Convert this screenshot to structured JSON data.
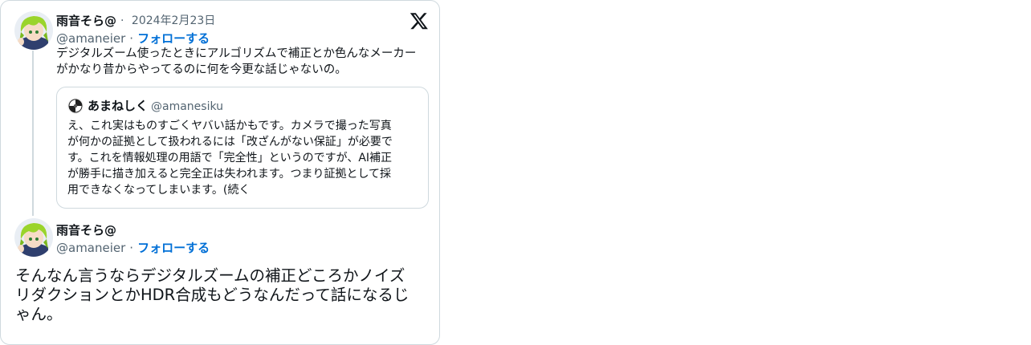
{
  "tweet1": {
    "name": "雨音そら@",
    "date": "2024年2月23日",
    "handle": "@amaneier",
    "follow": "フォローする",
    "text_lines": [
      "デジタルズーム使ったときにアルゴリズムで補正とか色んなメーカー",
      "がかなり昔からやってるのに何を今更な話じゃないの。"
    ]
  },
  "quote": {
    "name": "あまねしく",
    "handle": "@amanesiku",
    "text_lines": [
      "え、これ実はものすごくヤバい話かもです。カメラで撮った写真",
      "が何かの証拠として扱われるには「改ざんがない保証」が必要で",
      "す。これを情報処理の用語で「完全性」というのですが、AI補正",
      "が勝手に描き加えると完全正は失われます。つまり証拠として採",
      "用できなくなってしまいます。(続く"
    ]
  },
  "tweet2": {
    "name": "雨音そら@",
    "handle": "@amaneier",
    "follow": "フォローする",
    "text_lines": [
      "そんなん言うならデジタルズームの補正どころかノイズ",
      "リダクションとかHDR合成もどうなんだって話になるじ",
      "ゃん。"
    ]
  },
  "sep": "·",
  "icons": {
    "brand": "x-logo-icon"
  },
  "colors": {
    "follow": "#006fd6",
    "muted": "#536471",
    "border": "#cfd9de"
  }
}
